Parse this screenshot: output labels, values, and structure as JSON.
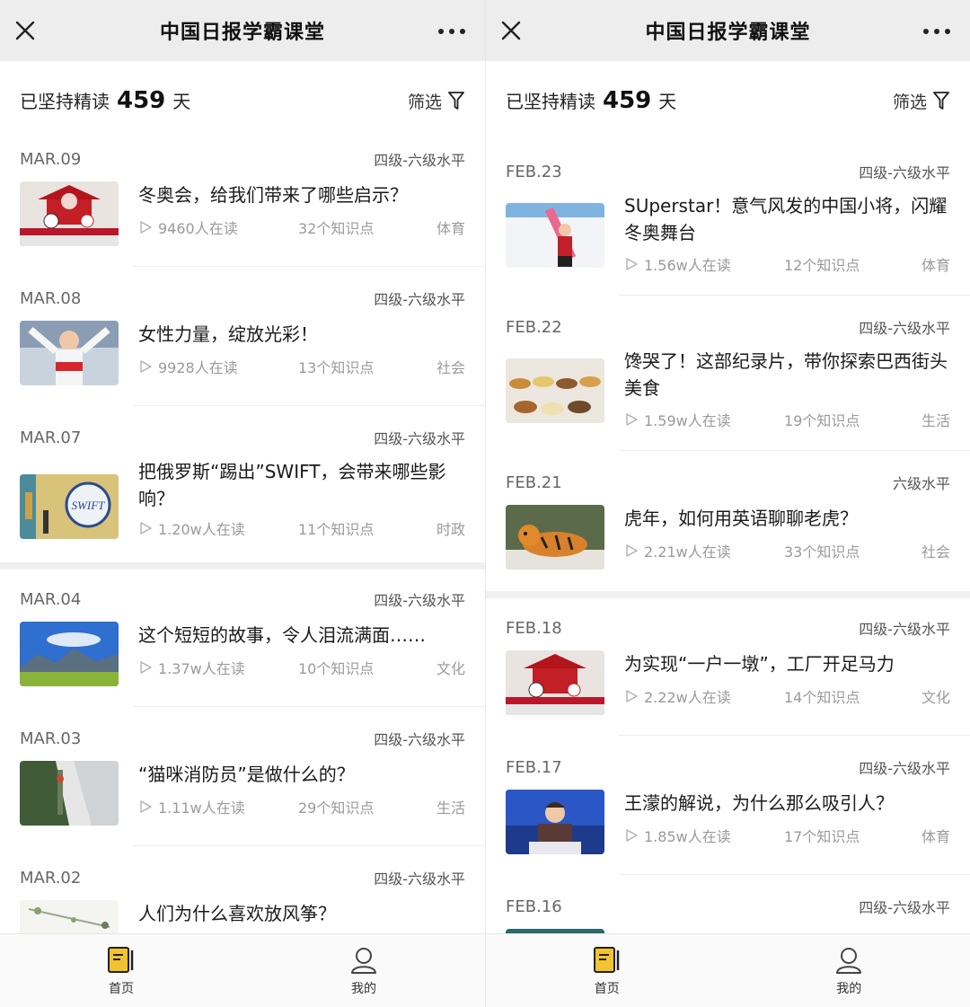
{
  "left": {
    "title": "中国日报学霸课堂",
    "streak": {
      "prefix": "已坚持精读",
      "days": "459",
      "suffix": "天"
    },
    "filter_label": "筛选",
    "items": [
      {
        "date": "MAR.09",
        "level": "四级-六级水平",
        "title": "冬奥会，给我们带来了哪些启示？",
        "readers": "9460人在读",
        "points": "32个知识点",
        "category": "体育"
      },
      {
        "date": "MAR.08",
        "level": "四级-六级水平",
        "title": "女性力量，绽放光彩！",
        "readers": "9928人在读",
        "points": "13个知识点",
        "category": "社会"
      },
      {
        "date": "MAR.07",
        "level": "四级-六级水平",
        "title": "把俄罗斯“踢出”SWIFT，会带来哪些影响？",
        "readers": "1.20w人在读",
        "points": "11个知识点",
        "category": "时政"
      },
      {
        "date": "MAR.04",
        "level": "四级-六级水平",
        "title": "这个短短的故事，令人泪流满面……",
        "readers": "1.37w人在读",
        "points": "10个知识点",
        "category": "文化"
      },
      {
        "date": "MAR.03",
        "level": "四级-六级水平",
        "title": "“猫咪消防员”是做什么的？",
        "readers": "1.11w人在读",
        "points": "29个知识点",
        "category": "生活"
      },
      {
        "date": "MAR.02",
        "level": "四级-六级水平",
        "title": "人们为什么喜欢放风筝？",
        "readers": "",
        "points": "",
        "category": ""
      }
    ],
    "tabs": [
      {
        "label": "首页"
      },
      {
        "label": "我的"
      }
    ]
  },
  "right": {
    "title": "中国日报学霸课堂",
    "streak": {
      "prefix": "已坚持精读",
      "days": "459",
      "suffix": "天"
    },
    "filter_label": "筛选",
    "items": [
      {
        "date": "FEB.23",
        "level": "四级-六级水平",
        "title": "SUperstar！意气风发的中国小将，闪耀冬奥舞台",
        "readers": "1.56w人在读",
        "points": "12个知识点",
        "category": "体育"
      },
      {
        "date": "FEB.22",
        "level": "四级-六级水平",
        "title": "馋哭了！这部纪录片，带你探索巴西街头美食",
        "readers": "1.59w人在读",
        "points": "19个知识点",
        "category": "生活"
      },
      {
        "date": "FEB.21",
        "level": "六级水平",
        "title": "虎年，如何用英语聊聊老虎？",
        "readers": "2.21w人在读",
        "points": "33个知识点",
        "category": "社会"
      },
      {
        "date": "FEB.18",
        "level": "四级-六级水平",
        "title": "为实现“一户一墩”，工厂开足马力",
        "readers": "2.22w人在读",
        "points": "14个知识点",
        "category": "文化"
      },
      {
        "date": "FEB.17",
        "level": "四级-六级水平",
        "title": "王濛的解说，为什么那么吸引人？",
        "readers": "1.85w人在读",
        "points": "17个知识点",
        "category": "体育"
      },
      {
        "date": "FEB.16",
        "level": "四级-六级水平",
        "title": "",
        "readers": "",
        "points": "",
        "category": ""
      }
    ],
    "tabs": [
      {
        "label": "首页"
      },
      {
        "label": "我的"
      }
    ]
  },
  "colors": {
    "topbar": "#ededed",
    "tab_accent": "#f2c230",
    "meta": "#9a9a9a"
  }
}
